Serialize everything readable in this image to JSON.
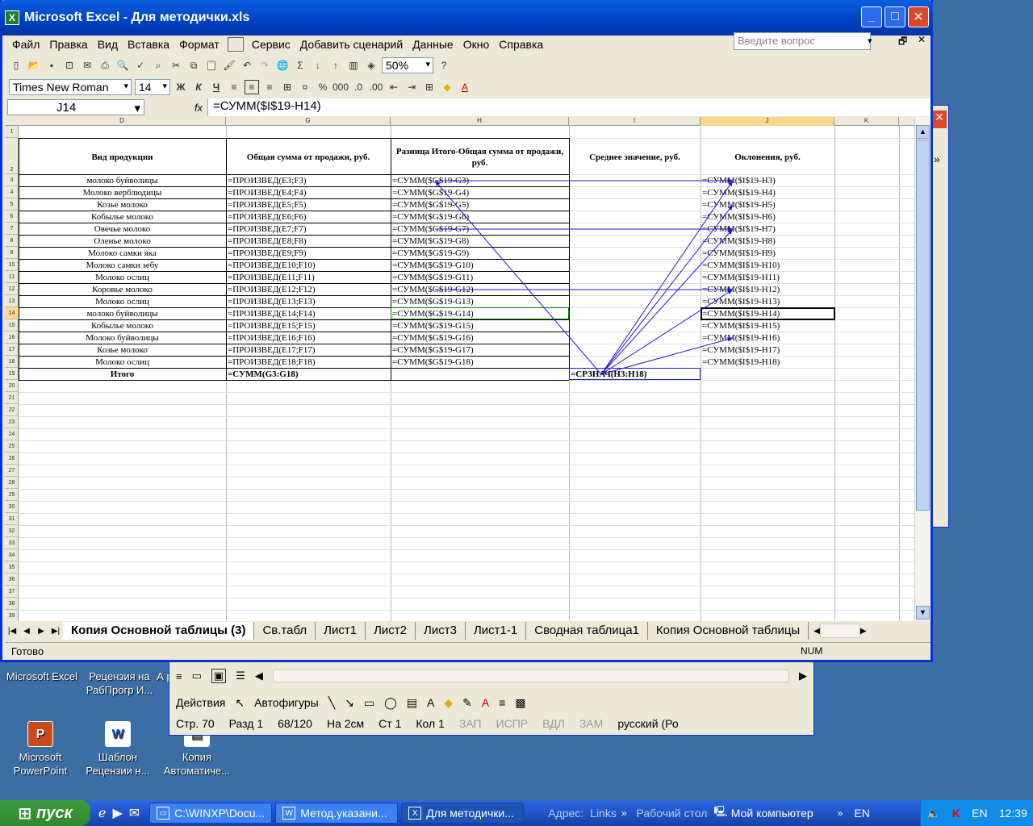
{
  "desktop": {
    "icons": [
      {
        "label": "Microsoft Excel",
        "icon": "excel-icon"
      },
      {
        "label": "Рецензия на РабПрогр И...",
        "icon": "word-doc-icon"
      },
      {
        "label": "А р",
        "icon": "doc-icon"
      },
      {
        "label": "Microsoft PowerPoint",
        "icon": "powerpoint-icon"
      },
      {
        "label": "Шаблон Рецензии н...",
        "icon": "word-doc-icon"
      },
      {
        "label": "Копия Автоматиче...",
        "icon": "doc-icon"
      }
    ]
  },
  "word_window": {
    "draw_toolbar": {
      "actions": "Действия",
      "autoshapes": "Автофигуры"
    },
    "status": {
      "page": "Стр. 70",
      "section": "Разд 1",
      "pages": "68/120",
      "at": "На 2см",
      "line": "Ст 1",
      "col": "Кол 1",
      "rec": "ЗАП",
      "trk": "ИСПР",
      "ext": "ВДЛ",
      "ovr": "ЗАМ",
      "lang": "русский (Ро"
    }
  },
  "excel": {
    "title": "Microsoft Excel - Для методички.xls",
    "menu": [
      "Файл",
      "Правка",
      "Вид",
      "Вставка",
      "Формат",
      "Сервис",
      "Добавить сценарий",
      "Данные",
      "Окно",
      "Справка"
    ],
    "ask_placeholder": "Введите вопрос",
    "toolbar": {
      "zoom": "50%"
    },
    "format_toolbar": {
      "font": "Times New Roman",
      "size": "14",
      "bold": "Ж",
      "italic": "К",
      "underline": "Ч"
    },
    "name_box": "J14",
    "fx_label": "fx",
    "formula": "=СУММ($I$19-H14)",
    "columns": [
      "D",
      "G",
      "H",
      "I",
      "J",
      "K"
    ],
    "headers": {
      "D": "Вид продукции",
      "G": "Общая сумма от продажи, руб.",
      "H": "Разница Итого-Общая сумма от продажи, руб.",
      "I": "Среднее значение, руб.",
      "J": "Оклонения, руб."
    },
    "rows": [
      {
        "n": "3",
        "D": "молоко буйволицы",
        "G": "=ПРОИЗВЕД(E3;F3)",
        "H": "=СУММ($G$19-G3)",
        "J": "=СУММ($I$19-H3)"
      },
      {
        "n": "4",
        "D": "Молоко верблюдицы",
        "G": "=ПРОИЗВЕД(E4;F4)",
        "H": "=СУММ($G$19-G4)",
        "J": "=СУММ($I$19-H4)"
      },
      {
        "n": "5",
        "D": "Козье молоко",
        "G": "=ПРОИЗВЕД(E5;F5)",
        "H": "=СУММ($G$19-G5)",
        "J": "=СУММ($I$19-H5)"
      },
      {
        "n": "6",
        "D": "Кобылье молоко",
        "G": "=ПРОИЗВЕД(E6;F6)",
        "H": "=СУММ($G$19-G6)",
        "J": "=СУММ($I$19-H6)"
      },
      {
        "n": "7",
        "D": "Овечье молоко",
        "G": "=ПРОИЗВЕД(E7;F7)",
        "H": "=СУММ($G$19-G7)",
        "J": "=СУММ($I$19-H7)"
      },
      {
        "n": "8",
        "D": "Оленье молоко",
        "G": "=ПРОИЗВЕД(E8;F8)",
        "H": "=СУММ($G$19-G8)",
        "J": "=СУММ($I$19-H8)"
      },
      {
        "n": "9",
        "D": "Молоко самки яка",
        "G": "=ПРОИЗВЕД(E9;F9)",
        "H": "=СУММ($G$19-G9)",
        "J": "=СУММ($I$19-H9)"
      },
      {
        "n": "10",
        "D": "Молоко самки зебу",
        "G": "=ПРОИЗВЕД(E10;F10)",
        "H": "=СУММ($G$19-G10)",
        "J": "=СУММ($I$19-H10)"
      },
      {
        "n": "11",
        "D": "Молоко ослиц",
        "G": "=ПРОИЗВЕД(E11;F11)",
        "H": "=СУММ($G$19-G11)",
        "J": "=СУММ($I$19-H11)"
      },
      {
        "n": "12",
        "D": "Коровье молоко",
        "G": "=ПРОИЗВЕД(E12;F12)",
        "H": "=СУММ($G$19-G12)",
        "J": "=СУММ($I$19-H12)"
      },
      {
        "n": "13",
        "D": "Молоко ослиц",
        "G": "=ПРОИЗВЕД(E13;F13)",
        "H": "=СУММ($G$19-G13)",
        "J": "=СУММ($I$19-H13)"
      },
      {
        "n": "14",
        "D": "молоко буйволицы",
        "G": "=ПРОИЗВЕД(E14;F14)",
        "H": "=СУММ($G$19-G14)",
        "J": "=СУММ($I$19-H14)"
      },
      {
        "n": "15",
        "D": "Кобылье молоко",
        "G": "=ПРОИЗВЕД(E15;F15)",
        "H": "=СУММ($G$19-G15)",
        "J": "=СУММ($I$19-H15)"
      },
      {
        "n": "16",
        "D": "Молоко буйволицы",
        "G": "=ПРОИЗВЕД(E16;F16)",
        "H": "=СУММ($G$19-G16)",
        "J": "=СУММ($I$19-H16)"
      },
      {
        "n": "17",
        "D": "Козье молоко",
        "G": "=ПРОИЗВЕД(E17;F17)",
        "H": "=СУММ($G$19-G17)",
        "J": "=СУММ($I$19-H17)"
      },
      {
        "n": "18",
        "D": "Молоко ослиц",
        "G": "=ПРОИЗВЕД(E18;F18)",
        "H": "=СУММ($G$19-G18)",
        "J": "=СУММ($I$19-H18)"
      }
    ],
    "total": {
      "D": "Итого",
      "G": "=СУММ(G3:G18)",
      "I": "=СРЗНАЧ(H3:H18)"
    },
    "row_numbers": [
      "1",
      "2",
      "3",
      "4",
      "5",
      "6",
      "7",
      "8",
      "9",
      "10",
      "11",
      "12",
      "13",
      "14",
      "15",
      "16",
      "17",
      "18",
      "19",
      "20",
      "21",
      "22",
      "23",
      "24",
      "25",
      "26",
      "27",
      "28",
      "29",
      "30",
      "31",
      "32",
      "33",
      "34",
      "35",
      "36",
      "37",
      "38",
      "39"
    ],
    "sheets": [
      "Копия Основной таблицы (3)",
      "Св.табл",
      "Лист1",
      "Лист2",
      "Лист3",
      "Лист1-1",
      "Сводная таблица1",
      "Копия Основной таблицы"
    ],
    "status": {
      "ready": "Готово",
      "num": "NUM"
    }
  },
  "taskbar": {
    "start": "пуск",
    "tasks": [
      {
        "label": "C:\\WINXP\\Docu...",
        "icon": "folder-icon"
      },
      {
        "label": "Метод.указани...",
        "icon": "word-icon"
      },
      {
        "label": "Для методички...",
        "icon": "excel-icon"
      }
    ],
    "address_label": "Адрес:",
    "links": "Links",
    "desktop": "Рабочий стол",
    "mycomp": "Мой компьютер",
    "lang1": "EN",
    "lang2": "EN",
    "clock": "12:39"
  },
  "colors": {
    "selection": "#fbd68c",
    "trace_arrow": "#1a1ad6",
    "xp_blue": "#0831d9"
  }
}
